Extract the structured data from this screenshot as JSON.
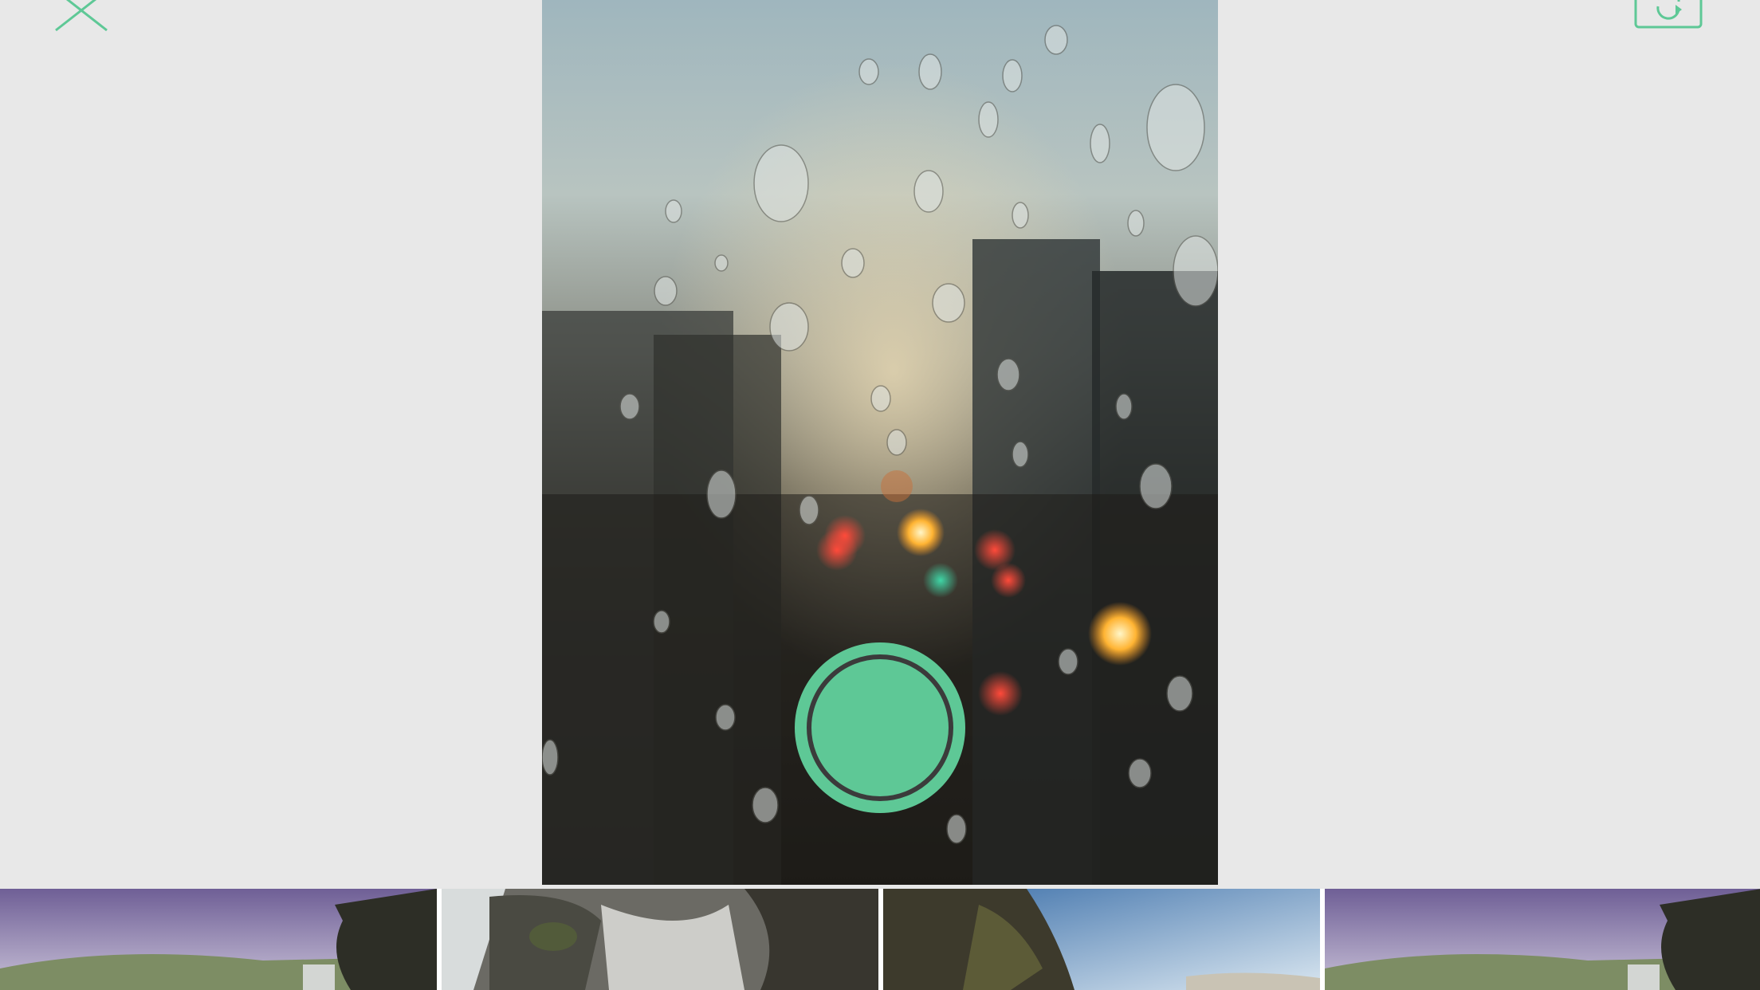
{
  "app": {
    "accent_color": "#5ec896",
    "background_color": "#e8e8e8"
  },
  "controls": {
    "close_icon": "close-icon",
    "flip_icon": "camera-flip-icon",
    "shutter_icon": "shutter-button"
  },
  "preview": {
    "subject": "rain-drops-on-window-city-bokeh"
  },
  "thumbnails": [
    {
      "subject": "waterfall-valley-purple-sky"
    },
    {
      "subject": "waterfall-rocks-closeup"
    },
    {
      "subject": "cliff-blue-sky"
    },
    {
      "subject": "waterfall-valley-purple-sky"
    }
  ]
}
